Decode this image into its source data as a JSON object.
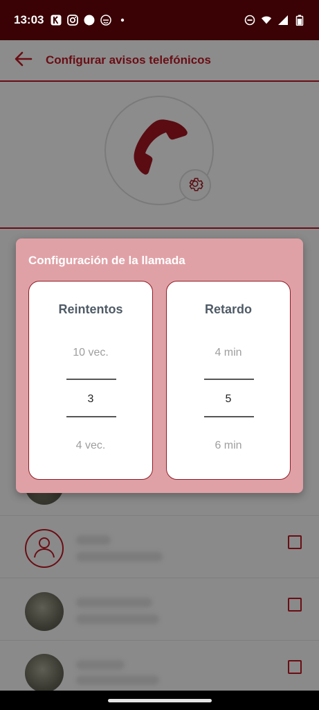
{
  "status_bar": {
    "time": "13:03"
  },
  "app_bar": {
    "title": "Configurar avisos telefónicos"
  },
  "dialog": {
    "title": "Configuración de la llamada",
    "retries": {
      "label": "Reintentos",
      "above": "10 vec.",
      "selected": "3",
      "below": "4 vec."
    },
    "delay": {
      "label": "Retardo",
      "above": "4 min",
      "selected": "5",
      "below": "6 min"
    }
  },
  "colors": {
    "accent": "#6a0d14",
    "dialog_bg": "#e0a1a6",
    "status_bar_bg": "#3a0205"
  }
}
